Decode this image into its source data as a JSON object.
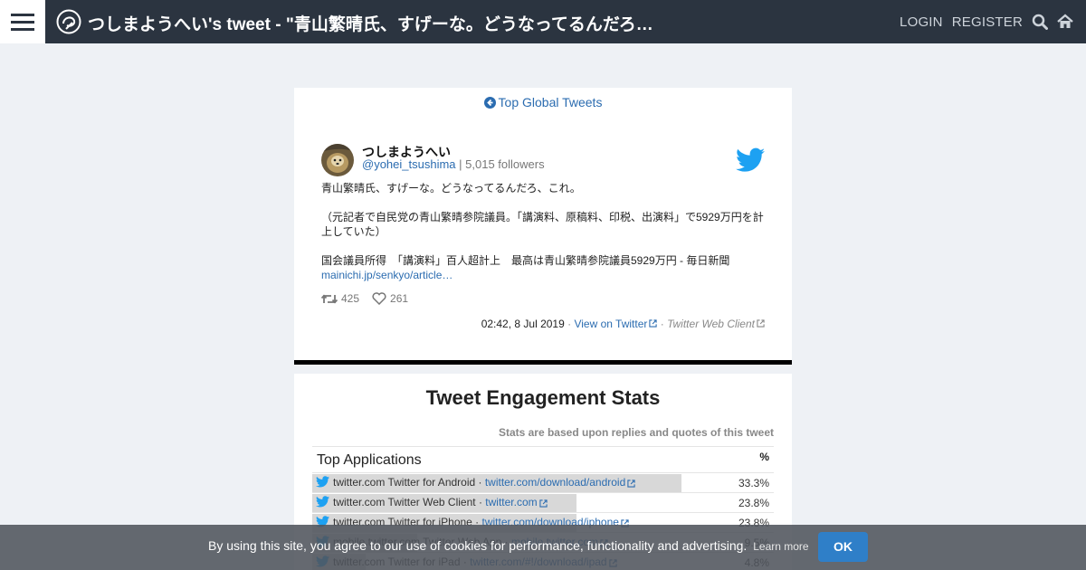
{
  "header": {
    "title": "つしまようへい's tweet - \"青山繁晴氏、すげーな。どうなってるんだろ…",
    "login_label": "LOGIN",
    "register_label": "REGISTER",
    "icons": [
      "menu-icon",
      "logo-icon",
      "search-icon",
      "home-icon"
    ]
  },
  "tweet": {
    "top_link": "Top Global Tweets",
    "user_name": "つしまようへい",
    "handle": "@yohei_tsushima",
    "followers": "| 5,015 followers",
    "lines": [
      "青山繁晴氏、すげーな。どうなってるんだろ、これ。",
      "（元記者で自民党の青山繁晴参院議員。「講演料、原稿料、印税、出演料」で5929万円を計上していた）",
      "国会議員所得　「講演料」百人超計上　最高は青山繁晴参院議員5929万円 - 毎日新聞"
    ],
    "link_text": "mainichi.jp/senkyo/article…",
    "retweets": "425",
    "likes": "261",
    "date": "02:42, 8 Jul 2019",
    "view_on_twitter": "View on Twitter",
    "client": "Twitter Web Client",
    "separator": "·"
  },
  "stats": {
    "title": "Tweet Engagement Stats",
    "note": "Stats are based upon replies and quotes of this tweet",
    "section_label": "Top Applications",
    "percent_header": "%",
    "rows": [
      {
        "name": "twitter.com Twitter for Android",
        "link": "twitter.com/download/android",
        "pct": "33.3%",
        "share": 0.333
      },
      {
        "name": "twitter.com Twitter Web Client",
        "link": "twitter.com",
        "pct": "23.8%",
        "share": 0.238
      },
      {
        "name": "twitter.com Twitter for iPhone",
        "link": "twitter.com/download/iphone",
        "pct": "23.8%",
        "share": 0.238
      },
      {
        "name": "mobile.twitter.com Twitter Web App",
        "link": "mobile.twitter.com",
        "pct": "9.5%",
        "share": 0.095
      },
      {
        "name": "twitter.com Twitter for iPad",
        "link": "twitter.com/#!/download/ipad",
        "pct": "4.8%",
        "share": 0.048
      }
    ]
  },
  "cookie": {
    "text": "By using this site, you agree to our use of cookies for performance, functionality and advertising.",
    "learn_more": "Learn more",
    "ok_label": "OK"
  },
  "colors": {
    "header_bg": "#2b3440",
    "link": "#2b6cb0",
    "twitter_blue": "#1da1f2",
    "ok_button": "#2f7fc8"
  }
}
